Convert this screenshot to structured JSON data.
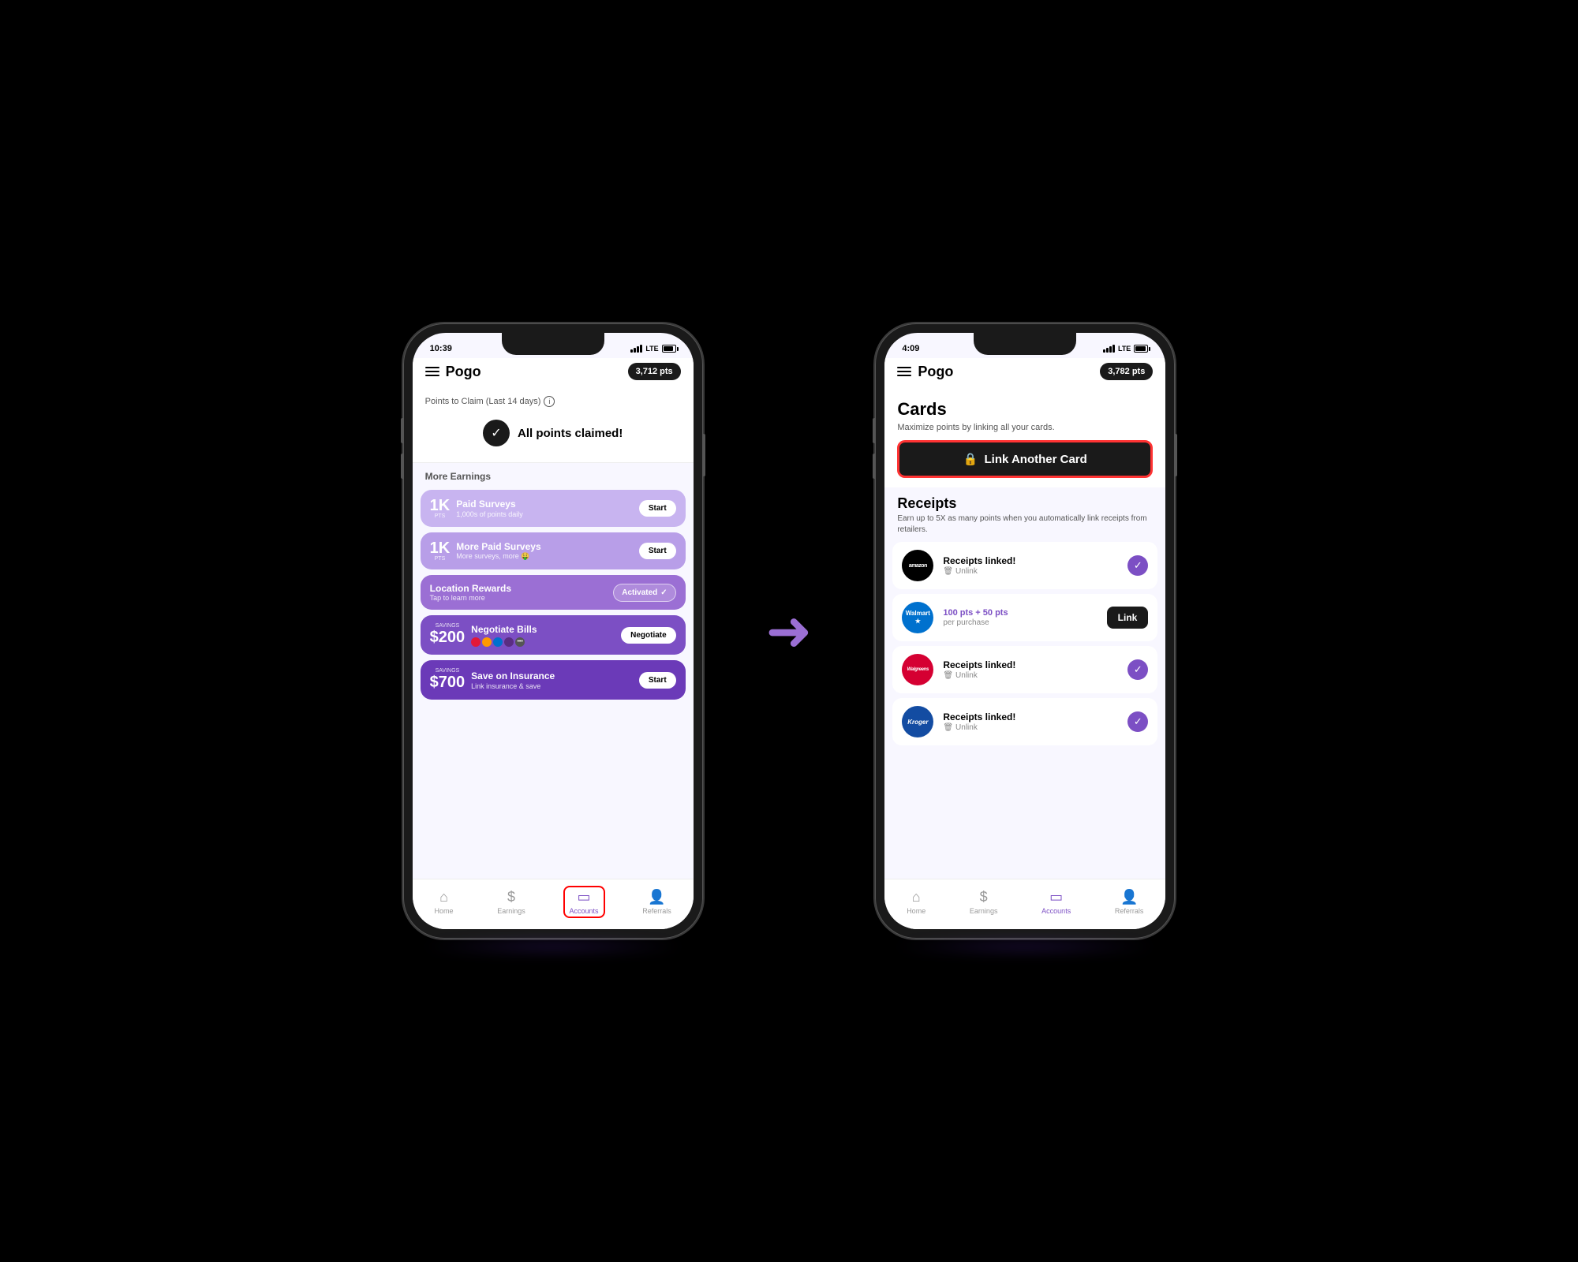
{
  "scene": {
    "background": "#000000"
  },
  "phone1": {
    "status": {
      "time": "10:39",
      "signal": "LTE",
      "battery": "80"
    },
    "header": {
      "logo": "Pogo",
      "points": "3,712 pts"
    },
    "points_section": {
      "label": "Points to Claim (Last 14 days)",
      "claimed_text": "All points claimed!"
    },
    "more_earnings": {
      "label": "More Earnings",
      "items": [
        {
          "amount": "1K",
          "unit": "PTS",
          "title": "Paid Surveys",
          "subtitle": "1,000s of points daily",
          "action": "Start",
          "color": "purple-light"
        },
        {
          "amount": "1K",
          "unit": "PTS",
          "title": "More Paid Surveys",
          "subtitle": "More surveys, more 🤑",
          "action": "Start",
          "color": "purple-mid"
        },
        {
          "amount": "",
          "unit": "",
          "title": "Location Rewards",
          "subtitle": "Tap to learn more",
          "action": "Activated",
          "color": "purple-bright"
        },
        {
          "amount": "$200",
          "unit": "SAVINGS",
          "title": "Negotiate Bills",
          "subtitle": "",
          "action": "Negotiate",
          "color": "purple-dark"
        },
        {
          "amount": "$700",
          "unit": "SAVINGS",
          "title": "Save on Insurance",
          "subtitle": "Link insurance & save",
          "action": "Start",
          "color": "purple-deep"
        }
      ]
    },
    "nav": {
      "items": [
        {
          "label": "Home",
          "icon": "house",
          "active": false
        },
        {
          "label": "Earnings",
          "icon": "dollar",
          "active": false
        },
        {
          "label": "Accounts",
          "icon": "card",
          "active": true,
          "highlighted": true
        },
        {
          "label": "Referrals",
          "icon": "person",
          "active": false
        }
      ]
    }
  },
  "arrow": {
    "symbol": "➜"
  },
  "phone2": {
    "status": {
      "time": "4:09",
      "signal": "LTE",
      "battery": "90"
    },
    "header": {
      "logo": "Pogo",
      "points": "3,782 pts"
    },
    "cards_section": {
      "title": "Cards",
      "subtitle": "Maximize points by linking all your cards.",
      "link_button": "Link Another Card"
    },
    "receipts_section": {
      "title": "Receipts",
      "subtitle": "Earn up to 5X as many points when you automatically link receipts from retailers.",
      "items": [
        {
          "retailer": "amazon",
          "logo_text": "amazon",
          "status": "Receipts linked!",
          "action": "Unlink",
          "action_type": "unlink",
          "linked": true
        },
        {
          "retailer": "walmart",
          "logo_text": "Walmart★",
          "status": "100 pts + 50 pts",
          "action": "per purchase",
          "action_type": "link",
          "linked": false,
          "link_label": "Link"
        },
        {
          "retailer": "walgreens",
          "logo_text": "Walgreens",
          "status": "Receipts linked!",
          "action": "Unlink",
          "action_type": "unlink",
          "linked": true
        },
        {
          "retailer": "kroger",
          "logo_text": "Kroger",
          "status": "Receipts linked!",
          "action": "Unlink",
          "action_type": "unlink",
          "linked": true
        }
      ]
    },
    "nav": {
      "items": [
        {
          "label": "Home",
          "icon": "house",
          "active": false
        },
        {
          "label": "Earnings",
          "icon": "dollar",
          "active": false
        },
        {
          "label": "Accounts",
          "icon": "card",
          "active": true
        },
        {
          "label": "Referrals",
          "icon": "person",
          "active": false
        }
      ]
    }
  }
}
